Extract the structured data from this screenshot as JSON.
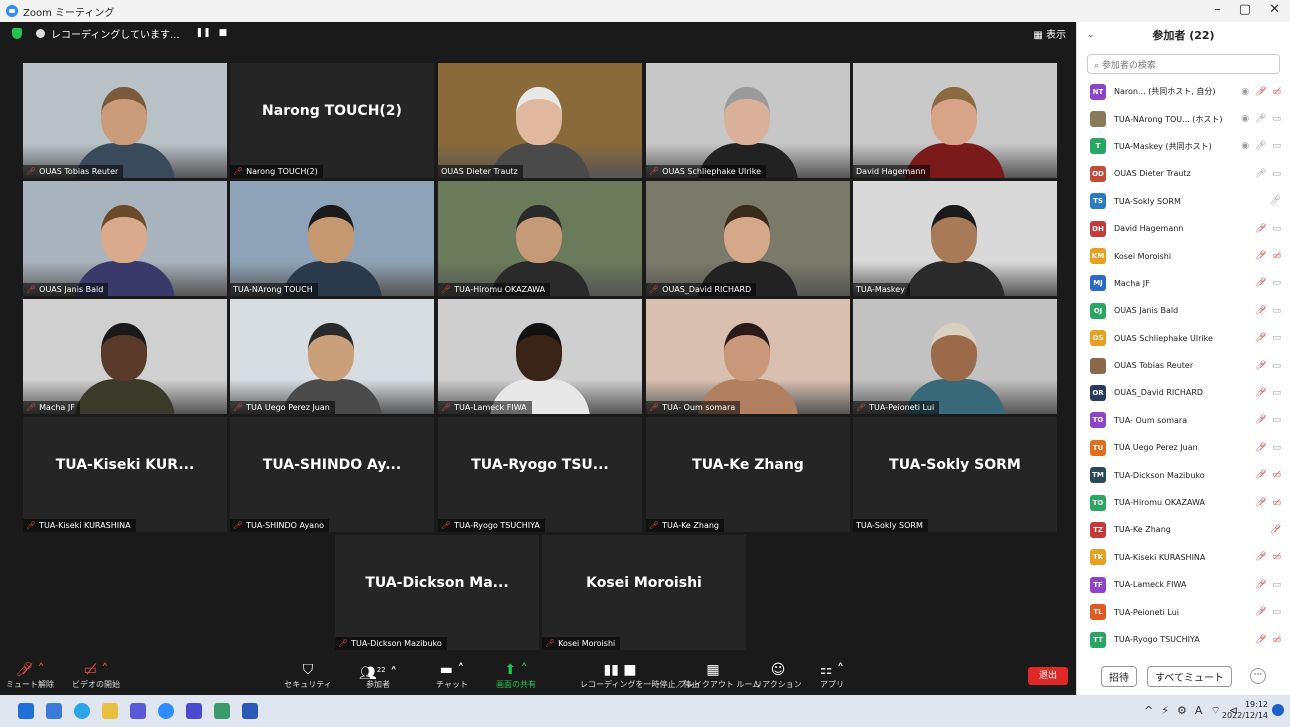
{
  "window": {
    "title": "Zoom ミーティング",
    "controls": [
      "–",
      "▢",
      "✕"
    ]
  },
  "meeting": {
    "recording_status": "レコーディングしています...",
    "recording_controls": [
      "❚❚",
      "■"
    ],
    "view_label": "▦ 表示",
    "tiles": [
      {
        "label": "OUAS Tobias Reuter",
        "big": "",
        "mic_off": true,
        "skin": "#c99b7a",
        "hair": "#7a5a3a",
        "shirt": "#3a4a5a",
        "bg": "#b9c2c7"
      },
      {
        "label": "Narong TOUCH(2)",
        "big": "Narong TOUCH(2)",
        "mic_off": true
      },
      {
        "label": "OUAS Dieter Trautz",
        "big": "",
        "mic_off": false,
        "skin": "#e0b8a0",
        "hair": "#e8e8e8",
        "shirt": "#4a4a4a",
        "bg": "#8a6a3a"
      },
      {
        "label": "OUAS Schliephake Ulrike",
        "big": "",
        "mic_off": true,
        "skin": "#d9b19a",
        "hair": "#9a9a9a",
        "shirt": "#222",
        "bg": "#c7c7c7"
      },
      {
        "label": "David Hagemann",
        "big": "",
        "mic_off": false,
        "skin": "#d7a487",
        "hair": "#8a6a40",
        "shirt": "#7a1a1a",
        "bg": "#c9c9c9"
      },
      {
        "label": "OUAS Janis Bald",
        "big": "",
        "mic_off": true,
        "skin": "#d9a98c",
        "hair": "#6a4a2a",
        "shirt": "#3a3a6a",
        "bg": "#a9b3bd"
      },
      {
        "label": "TUA-NArong TOUCH",
        "big": "",
        "mic_off": false,
        "active": true,
        "skin": "#c49870",
        "hair": "#1a1a1a",
        "shirt": "#2a3a4a",
        "bg": "#8fa3b8"
      },
      {
        "label": "TUA-Hiromu OKAZAWA",
        "big": "",
        "mic_off": true,
        "skin": "#c49a78",
        "hair": "#2a2a2a",
        "shirt": "#2a2a2a",
        "bg": "#6a7a5a"
      },
      {
        "label": "OUAS_David RICHARD",
        "big": "",
        "mic_off": true,
        "skin": "#d6a88a",
        "hair": "#3a2a1a",
        "shirt": "#222",
        "bg": "#7a7a6a"
      },
      {
        "label": "TUA-Maskey",
        "big": "",
        "mic_off": false,
        "skin": "#a97a58",
        "hair": "#1a1a1a",
        "shirt": "#2a2a2a",
        "bg": "#d9d9d9"
      },
      {
        "label": "Macha JF",
        "big": "",
        "mic_off": true,
        "skin": "#5a3a2a",
        "hair": "#1a1a1a",
        "shirt": "#3a3a2a",
        "bg": "#d0d0d0"
      },
      {
        "label": "TUA Uego Perez Juan",
        "big": "",
        "mic_off": true,
        "skin": "#c9a07a",
        "hair": "#2a2a2a",
        "shirt": "#4a4a4a",
        "bg": "#d8dde2"
      },
      {
        "label": "TUA-Lameck FIWA",
        "big": "",
        "mic_off": true,
        "skin": "#3a2418",
        "hair": "#111",
        "shirt": "#e8e8e8",
        "bg": "#cfcfcf"
      },
      {
        "label": "TUA- Oum somara",
        "big": "",
        "mic_off": true,
        "skin": "#c9987a",
        "hair": "#2a1a1a",
        "shirt": "#b08060",
        "bg": "#d9bfb0"
      },
      {
        "label": "TUA-Peioneti Lui",
        "big": "",
        "mic_off": true,
        "skin": "#9a6a4a",
        "hair": "#d9d0c0",
        "shirt": "#3a6a7a",
        "bg": "#c2c2c2"
      },
      {
        "label": "TUA-Kiseki KURASHINA",
        "big": "TUA-Kiseki KUR...",
        "mic_off": true
      },
      {
        "label": "TUA-SHINDO Ayano",
        "big": "TUA-SHINDO Ay...",
        "mic_off": true
      },
      {
        "label": "TUA-Ryogo TSUCHIYA",
        "big": "TUA-Ryogo TSU...",
        "mic_off": true
      },
      {
        "label": "TUA-Ke Zhang",
        "big": "TUA-Ke Zhang",
        "mic_off": true
      },
      {
        "label": "TUA-Sokly SORM",
        "big": "TUA-Sokly SORM",
        "mic_off": false
      },
      {
        "label": "TUA-Dickson Mazibuko",
        "big": "TUA-Dickson Ma...",
        "mic_off": true
      },
      {
        "label": "Kosei Moroishi",
        "big": "Kosei Moroishi",
        "mic_off": true
      }
    ]
  },
  "toolbar": {
    "unmute": "ミュート解除",
    "start_video": "ビデオの開始",
    "security": "セキュリティ",
    "participants": "参加者",
    "participants_count": "22",
    "chat": "チャット",
    "share_screen": "画面の共有",
    "recording": "レコーディングを一時停止／停止",
    "breakout": "ブレイクアウト ルーム",
    "reactions": "リアクション",
    "apps": "アプリ",
    "leave": "退出"
  },
  "panel": {
    "title": "参加者 (22)",
    "search_placeholder": "参加者の検索",
    "participants": [
      {
        "initials": "NT",
        "name": "Naron... (共同ホスト, 自分)",
        "color": "#8e44c9",
        "icons": "rec mo vo"
      },
      {
        "initials": "",
        "name": "TUA-NArong TOU... (ホスト)",
        "color": "#8a7a5a",
        "icons": "rec mu v"
      },
      {
        "initials": "T",
        "name": "TUA-Maskey (共同ホスト)",
        "color": "#2aa564",
        "icons": "rec mu v"
      },
      {
        "initials": "OD",
        "name": "OUAS Dieter Trautz",
        "color": "#c44a3a",
        "icons": "mu v"
      },
      {
        "initials": "TS",
        "name": "TUA-Sokly SORM",
        "color": "#2a7ac4",
        "icons": "mu"
      },
      {
        "initials": "DH",
        "name": "David Hagemann",
        "color": "#c43a3a",
        "icons": "mo v"
      },
      {
        "initials": "KM",
        "name": "Kosei Moroishi",
        "color": "#e8a020",
        "icons": "mo vo"
      },
      {
        "initials": "MJ",
        "name": "Macha JF",
        "color": "#2a6ac4",
        "icons": "mo v"
      },
      {
        "initials": "OJ",
        "name": "OUAS Janis Bald",
        "color": "#2aa564",
        "icons": "mo v"
      },
      {
        "initials": "OS",
        "name": "OUAS Schliephake Ulrike",
        "color": "#e8a020",
        "icons": "mo v"
      },
      {
        "initials": "",
        "name": "OUAS Tobias Reuter",
        "color": "#8a6a4a",
        "icons": "mo v"
      },
      {
        "initials": "OR",
        "name": "OUAS_David RICHARD",
        "color": "#2a3a5a",
        "icons": "mo v"
      },
      {
        "initials": "TO",
        "name": "TUA- Oum somara",
        "color": "#8e44c9",
        "icons": "mo v"
      },
      {
        "initials": "TU",
        "name": "TUA Uego Perez Juan",
        "color": "#e07020",
        "icons": "mo v"
      },
      {
        "initials": "TM",
        "name": "TUA-Dickson Mazibuko",
        "color": "#2a4a5a",
        "icons": "mo vo"
      },
      {
        "initials": "TO",
        "name": "TUA-Hiromu OKAZAWA",
        "color": "#2aa564",
        "icons": "mo vo"
      },
      {
        "initials": "TZ",
        "name": "TUA-Ke Zhang",
        "color": "#c43a3a",
        "icons": "mo"
      },
      {
        "initials": "TK",
        "name": "TUA-Kiseki KURASHINA",
        "color": "#e8a020",
        "icons": "mo vo"
      },
      {
        "initials": "TF",
        "name": "TUA-Lameck FIWA",
        "color": "#8e44c9",
        "icons": "mo v"
      },
      {
        "initials": "TL",
        "name": "TUA-Peioneti Lui",
        "color": "#e05a20",
        "icons": "mo v"
      },
      {
        "initials": "TT",
        "name": "TUA-Ryogo TSUCHIYA",
        "color": "#2aa564",
        "icons": "mo vo"
      }
    ],
    "invite": "招待",
    "mute_all": "すべてミュート",
    "more": "···"
  },
  "taskbar": {
    "time": "19:12",
    "date": "2022/12/14",
    "tray": [
      "^",
      "⚡",
      "⚙",
      "A",
      "⌔",
      "⊲"
    ]
  }
}
